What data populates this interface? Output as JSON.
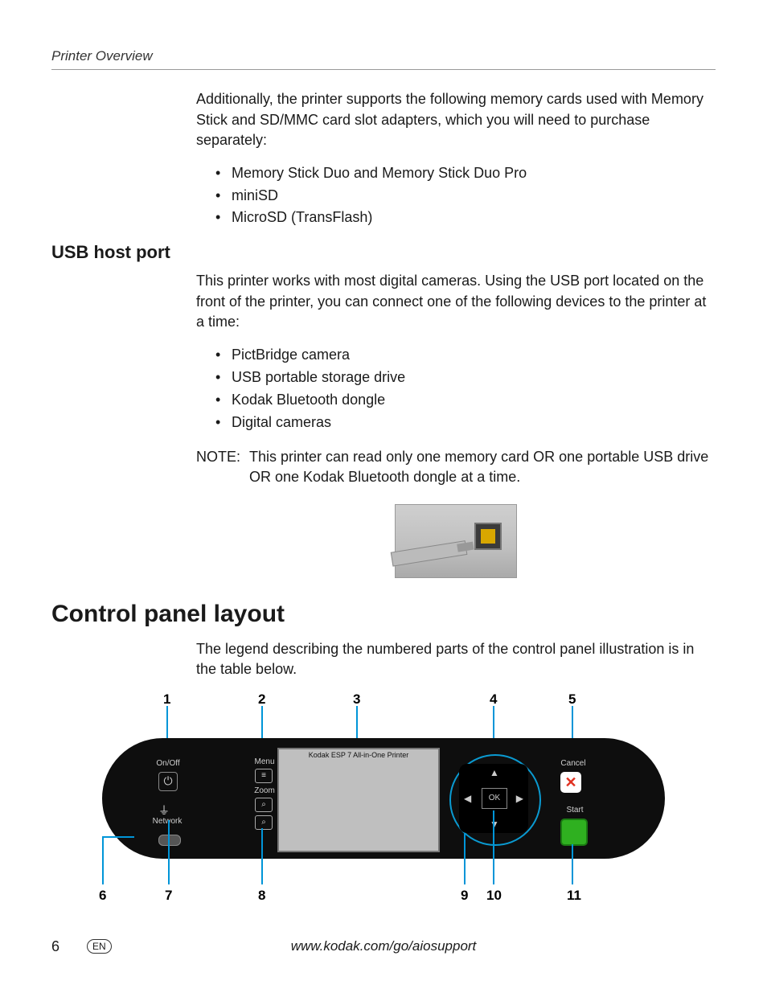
{
  "running_head": "Printer Overview",
  "intro_para": "Additionally, the printer supports the following memory cards used with Memory Stick and SD/MMC card slot adapters, which you will need to purchase separately:",
  "memory_cards": [
    "Memory Stick Duo and Memory Stick Duo Pro",
    "miniSD",
    "MicroSD (TransFlash)"
  ],
  "usb_section": {
    "heading": "USB host port",
    "para": "This printer works with most digital cameras. Using the USB port located on the front of the printer, you can connect one of the following devices to the printer at a time:",
    "devices": [
      "PictBridge camera",
      "USB portable storage drive",
      "Kodak Bluetooth dongle",
      "Digital cameras"
    ],
    "note_label": "NOTE:",
    "note_text": "This printer can read only one memory card OR one portable USB drive OR one Kodak Bluetooth dongle at a time."
  },
  "control_panel": {
    "heading": "Control panel layout",
    "para": "The legend describing the numbered parts of the control panel illustration is in the table below.",
    "screen_title": "Kodak ESP 7 All-in-One Printer",
    "labels": {
      "onoff": "On/Off",
      "network": "Network",
      "menu": "Menu",
      "zoom": "Zoom",
      "cancel": "Cancel",
      "start": "Start",
      "ok": "OK"
    },
    "callouts_top": [
      "1",
      "2",
      "3",
      "4",
      "5"
    ],
    "callouts_bottom": [
      "6",
      "7",
      "8",
      "9",
      "10",
      "11"
    ]
  },
  "footer": {
    "page": "6",
    "lang": "EN",
    "url": "www.kodak.com/go/aiosupport"
  }
}
